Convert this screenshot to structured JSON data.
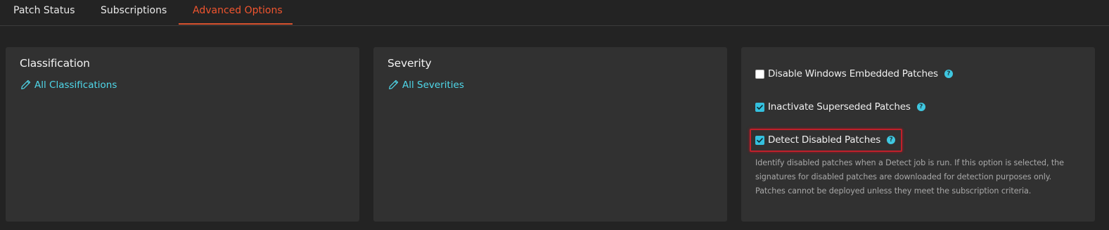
{
  "tabs": [
    {
      "label": "Patch Status",
      "active": false
    },
    {
      "label": "Subscriptions",
      "active": false
    },
    {
      "label": "Advanced Options",
      "active": true
    }
  ],
  "classification": {
    "title": "Classification",
    "link": "All Classifications"
  },
  "severity": {
    "title": "Severity",
    "link": "All Severities"
  },
  "options": {
    "disable_embedded": {
      "label": "Disable Windows Embedded Patches",
      "checked": false
    },
    "inactivate_superseded": {
      "label": "Inactivate Superseded Patches",
      "checked": true
    },
    "detect_disabled": {
      "label": "Detect Disabled Patches",
      "checked": true,
      "description": "Identify disabled patches when a Detect job is run. If this option is selected, the signatures for disabled patches are downloaded for detection purposes only. Patches cannot be deployed unless they meet the subscription criteria."
    }
  },
  "icons": {
    "edit": "pencil-icon",
    "help": "question-circle-icon",
    "checkbox_checked": "checkmark-icon"
  },
  "colors": {
    "background": "#232323",
    "panel": "#313131",
    "active_tab": "#f0552f",
    "link": "#4fd8ea",
    "checkbox": "#34c0de",
    "highlight": "#c0202a"
  }
}
